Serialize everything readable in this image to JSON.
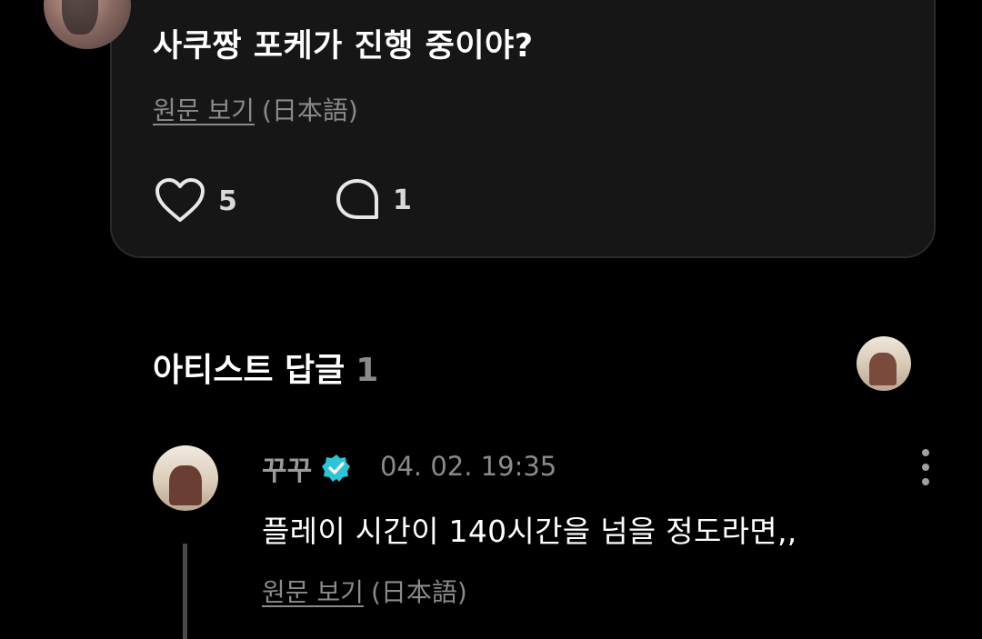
{
  "post": {
    "text": "사쿠짱 포케가 진행 중이야?",
    "translate_link": "원문 보기",
    "translate_lang": "(日本語)",
    "like_count": "5",
    "comment_count": "1",
    "like_icon": "heart-icon",
    "comment_icon": "speech-bubble-icon"
  },
  "artist_replies": {
    "title": "아티스트 답글",
    "count": "1"
  },
  "reply": {
    "author": "꾸꾸",
    "verified_icon": "verified-badge-icon",
    "timestamp": "04. 02. 19:35",
    "text": "플레이 시간이 140시간을 넘을 정도라면,,",
    "translate_link": "원문 보기",
    "translate_lang": "(日本語)",
    "more_icon": "more-vertical-icon"
  },
  "colors": {
    "background": "#000000",
    "card": "#161616",
    "card_border": "#2a2a2a",
    "muted_text": "#8a8a8a",
    "verified_badge": "#2ec4d6"
  }
}
